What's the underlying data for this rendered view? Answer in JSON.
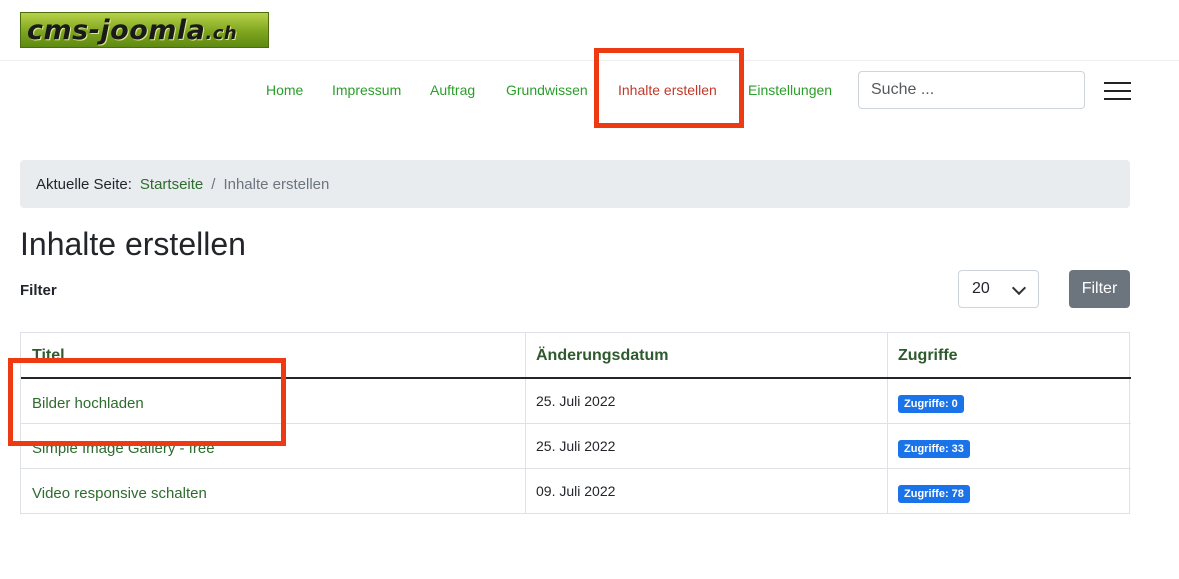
{
  "logo": {
    "text": "cms-joomla",
    "tld": ".ch"
  },
  "nav": {
    "items": [
      {
        "label": "Home"
      },
      {
        "label": "Impressum"
      },
      {
        "label": "Auftrag"
      },
      {
        "label": "Grundwissen"
      },
      {
        "label": "Inhalte erstellen",
        "active": true
      },
      {
        "label": "Einstellungen"
      }
    ]
  },
  "search": {
    "placeholder": "Suche ..."
  },
  "breadcrumb": {
    "label": "Aktuelle Seite:",
    "home": "Startseite",
    "separator": "/",
    "current": "Inhalte erstellen"
  },
  "page": {
    "title": "Inhalte erstellen"
  },
  "filter": {
    "label": "Filter",
    "limit_value": "20",
    "button_label": "Filter"
  },
  "table": {
    "headers": {
      "title": "Titel",
      "date": "Änderungsdatum",
      "hits": "Zugriffe"
    },
    "rows": [
      {
        "title": "Bilder hochladen",
        "date": "25. Juli 2022",
        "hits": "Zugriffe: 0"
      },
      {
        "title": "Simple Image Gallery - free",
        "date": "25. Juli 2022",
        "hits": "Zugriffe: 33"
      },
      {
        "title": "Video responsive schalten",
        "date": "09. Juli 2022",
        "hits": "Zugriffe: 78"
      }
    ]
  },
  "colors": {
    "nav_link": "#2a9e2a",
    "nav_active": "#c0392b",
    "highlight": "#ee3a12",
    "badge": "#1a73e8",
    "filter_button": "#6c757d"
  }
}
